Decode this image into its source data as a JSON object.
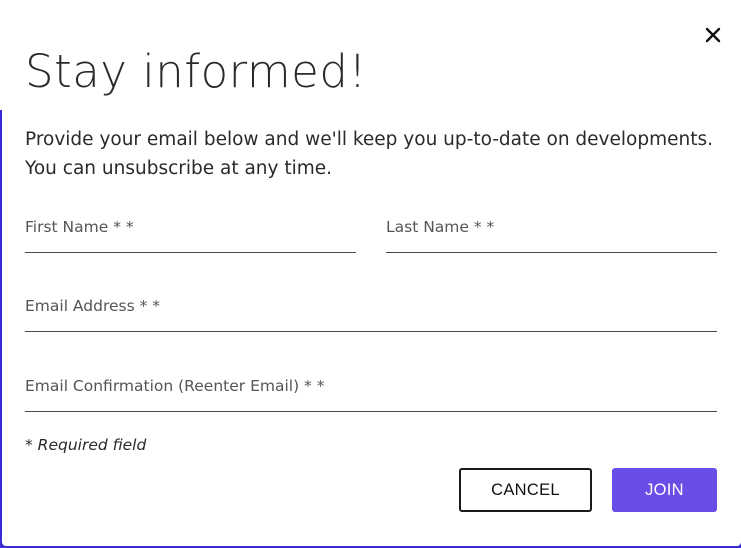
{
  "modal": {
    "title": "Stay informed!",
    "description_line1": "Provide your email below and we'll keep you up-to-date on developments.",
    "description_line2": "You can unsubscribe at any time.",
    "close_icon": "close-icon"
  },
  "form": {
    "first_name_label": "First Name * *",
    "last_name_label": "Last Name * *",
    "email_label": "Email Address * *",
    "email_confirm_label": "Email Confirmation (Reenter Email) * *",
    "required_note": "* Required field"
  },
  "actions": {
    "cancel_label": "CANCEL",
    "join_label": "JOIN"
  },
  "colors": {
    "backdrop": "#3b2cd6",
    "join_button": "#6a4ce6",
    "text": "#2a2a2a"
  }
}
